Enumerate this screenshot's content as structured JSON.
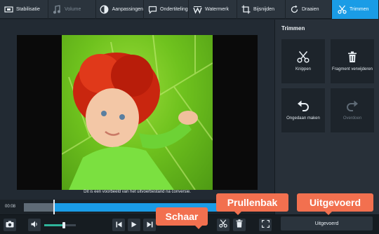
{
  "toolbar": {
    "tabs": [
      {
        "label": "Stabilisatie",
        "state": "normal",
        "icon": "stabilize-icon"
      },
      {
        "label": "Volume",
        "state": "disabled",
        "icon": "music-note-icon"
      },
      {
        "label": "Aanpassingen",
        "state": "normal",
        "icon": "contrast-icon"
      },
      {
        "label": "Ondertiteling",
        "state": "normal",
        "icon": "subtitle-bubble-icon"
      },
      {
        "label": "Watermerk",
        "state": "normal",
        "icon": "watermark-icon"
      },
      {
        "label": "Bijsnijden",
        "state": "normal",
        "icon": "crop-icon"
      },
      {
        "label": "Draaien",
        "state": "normal",
        "icon": "rotate-icon"
      },
      {
        "label": "Trimmen",
        "state": "active",
        "icon": "scissors-icon"
      }
    ]
  },
  "preview": {
    "caption": "Dit is een voorbeeld van het uitvoerbestand na conversie."
  },
  "panel": {
    "title": "Trimmen",
    "tiles": [
      {
        "label": "Knippen",
        "icon": "scissors-icon",
        "enabled": true
      },
      {
        "label": "Fragment verwijderen",
        "icon": "trash-icon",
        "enabled": true
      },
      {
        "label": "Ongedaan maken",
        "icon": "undo-icon",
        "enabled": true
      },
      {
        "label": "Overdoen",
        "icon": "redo-icon",
        "enabled": false
      }
    ]
  },
  "timeline": {
    "time": "00:08",
    "progress_fraction": 0.12,
    "selection_fraction": [
      0.12,
      1.0
    ]
  },
  "controls": {
    "volume_fraction": 0.62,
    "export_label": "Uitgevoerd"
  },
  "callouts": {
    "schaar": "Schaar",
    "prullenbak": "Prullenbak",
    "uitgevoerd": "Uitgevoerd"
  },
  "colors": {
    "accent": "#1a9ce6",
    "callout": "#f2704f",
    "volume": "#2fb49a"
  }
}
